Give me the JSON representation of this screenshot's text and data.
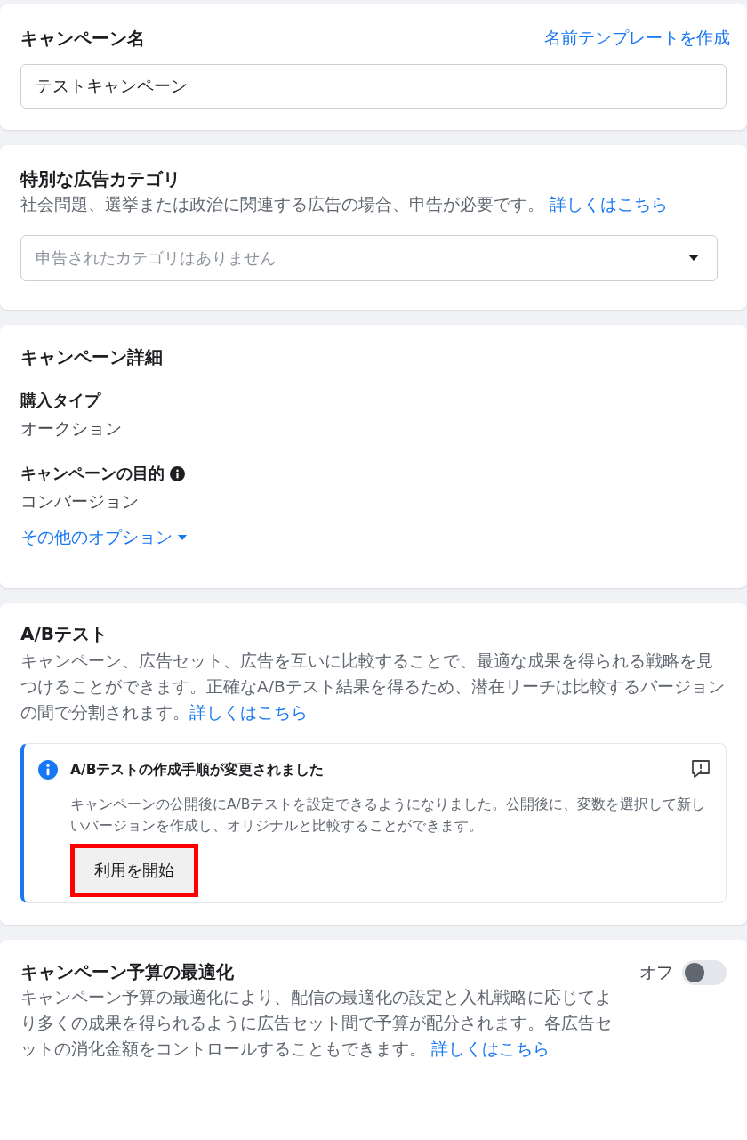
{
  "campaign_name": {
    "title": "キャンペーン名",
    "template_link": "名前テンプレートを作成",
    "value": "テストキャンペーン"
  },
  "special_category": {
    "title": "特別な広告カテゴリ",
    "description": "社会問題、選挙または政治に関連する広告の場合、申告が必要です。",
    "link": "詳しくはこちら",
    "placeholder": "申告されたカテゴリはありません"
  },
  "campaign_details": {
    "title": "キャンペーン詳細",
    "fields": [
      {
        "label": "購入タイプ",
        "value": "オークション",
        "info": false
      },
      {
        "label": "キャンペーンの目的",
        "value": "コンバージョン",
        "info": true
      }
    ],
    "more_options": "その他のオプション"
  },
  "ab_test": {
    "title": "A/Bテスト",
    "description": "キャンペーン、広告セット、広告を互いに比較することで、最適な成果を得られる戦略を見つけることができます。正確なA/Bテスト結果を得るため、潜在リーチは比較するバージョンの間で分割されます。",
    "link": "詳しくはこちら",
    "notice": {
      "title": "A/Bテストの作成手順が変更されました",
      "body": "キャンペーンの公開後にA/Bテストを設定できるようになりました。公開後に、変数を選択して新しいバージョンを作成し、オリジナルと比較することができます。",
      "button": "利用を開始",
      "highlighted": true
    }
  },
  "budget_optimization": {
    "title": "キャンペーン予算の最適化",
    "toggle_label": "オフ",
    "on": false,
    "description": "キャンペーン予算の最適化により、配信の最適化の設定と入札戦略に応じてより多くの成果を得られるように広告セット間で予算が配分されます。各広告セットの消化金額をコントロールすることもできます。",
    "link": "詳しくはこちら"
  }
}
